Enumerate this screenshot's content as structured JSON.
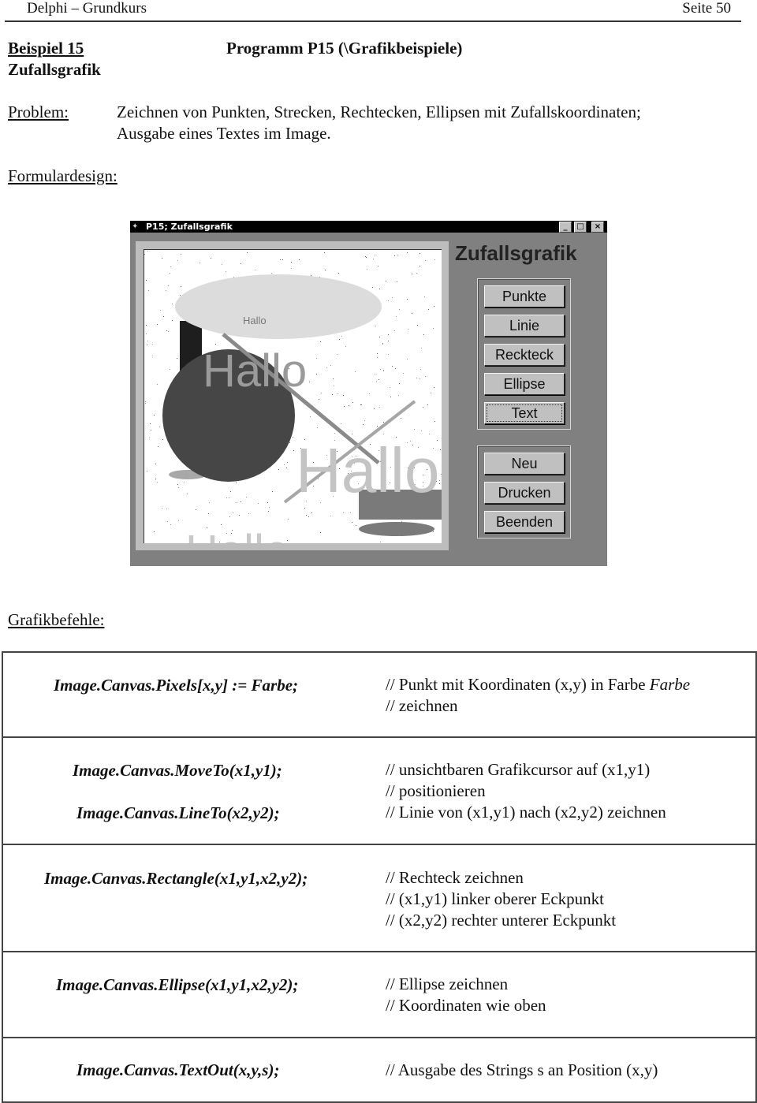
{
  "header": {
    "left": "Delphi – Grundkurs",
    "right": "Seite 50"
  },
  "example": {
    "number_label": "Beispiel 15",
    "name": "Zufallsgrafik",
    "program_title": "Programm P15 (\\Grafikbeispiele)"
  },
  "problem": {
    "label": "Problem:",
    "lines": [
      "Zeichnen von Punkten, Strecken, Rechtecken, Ellipsen mit Zufallskoordinaten;",
      "Ausgabe eines Textes im Image."
    ]
  },
  "form_design_label": "Formulardesign:",
  "window": {
    "title": "P15; Zufallsgrafik",
    "controls": {
      "minimize": "_",
      "maximize": "□",
      "close": "×"
    },
    "form_heading": "Zufallsgrafik",
    "button_group_1": [
      "Punkte",
      "Linie",
      "Reckteck",
      "Ellipse",
      "Text"
    ],
    "button_group_2": [
      "Neu",
      "Drucken",
      "Beenden"
    ],
    "canvas_texts": [
      "Hallo",
      "Hallo",
      "Hallo",
      "Hallo"
    ],
    "colors": {
      "window_bg": "#808080",
      "button_face": "#c0c0c0",
      "canvas_bg": "#ffffff",
      "dark_fill": "#464646",
      "light_fill": "#dcdcdc",
      "mid_fill": "#7a7a7a",
      "text_gray": "#c0c0c0"
    }
  },
  "commands_label": "Grafikbefehle:",
  "commands": [
    {
      "code": [
        "Image.Canvas.Pixels[x,y] := Farbe;"
      ],
      "comment": [
        "// Punkt mit Koordinaten (x,y) in Farbe ",
        "Farbe",
        "// zeichnen"
      ]
    },
    {
      "code": [
        "Image.Canvas.MoveTo(x1,y1);",
        "Image.Canvas.LineTo(x2,y2);"
      ],
      "comment": [
        "// unsichtbaren Grafikcursor auf (x1,y1)",
        "// positionieren",
        "// Linie von (x1,y1) nach (x2,y2) zeichnen"
      ]
    },
    {
      "code": [
        "Image.Canvas.Rectangle(x1,y1,x2,y2);"
      ],
      "comment": [
        "// Rechteck zeichnen",
        "// (x1,y1) linker oberer Eckpunkt",
        "// (x2,y2) rechter unterer Eckpunkt"
      ]
    },
    {
      "code": [
        "Image.Canvas.Ellipse(x1,y1,x2,y2);"
      ],
      "comment": [
        "// Ellipse zeichnen",
        "// Koordinaten wie oben"
      ]
    },
    {
      "code": [
        "Image.Canvas.TextOut(x,y,s);"
      ],
      "comment": [
        "// Ausgabe des Strings s an Position (x,y)"
      ]
    }
  ]
}
